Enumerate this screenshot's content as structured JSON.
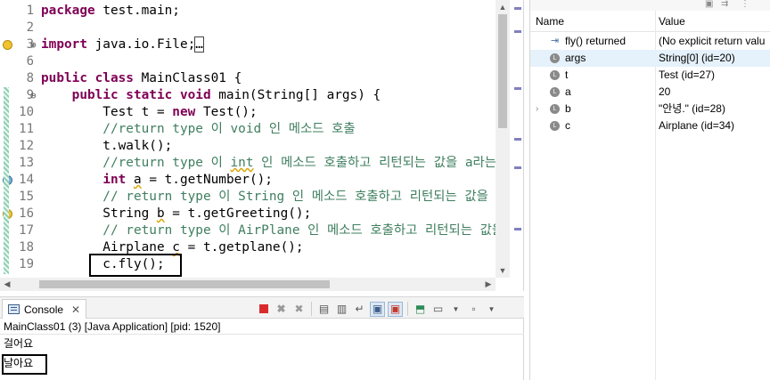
{
  "editor": {
    "lines": [
      {
        "num": "1",
        "marker": "",
        "fold": "",
        "segs": [
          [
            "kw",
            "package"
          ],
          [
            "tx",
            " test.main;"
          ]
        ]
      },
      {
        "num": "2",
        "marker": "",
        "fold": "",
        "segs": []
      },
      {
        "num": "3",
        "marker": "warn",
        "fold": "⊕",
        "segs": [
          [
            "kw",
            "import"
          ],
          [
            "tx",
            " java.io.File;"
          ],
          [
            "box",
            "…"
          ]
        ]
      },
      {
        "num": "6",
        "marker": "",
        "fold": "",
        "segs": []
      },
      {
        "num": "8",
        "marker": "",
        "fold": "",
        "segs": [
          [
            "kw",
            "public class"
          ],
          [
            "tx",
            " MainClass01 {"
          ]
        ]
      },
      {
        "num": "9",
        "marker": "",
        "fold": "⊖",
        "segs": [
          [
            "tx",
            "    "
          ],
          [
            "kw",
            "public static void"
          ],
          [
            "tx",
            " main(String[] args) {"
          ]
        ]
      },
      {
        "num": "10",
        "marker": "",
        "fold": "",
        "segs": [
          [
            "tx",
            "        Test t = "
          ],
          [
            "kw",
            "new"
          ],
          [
            "tx",
            " Test();"
          ]
        ]
      },
      {
        "num": "11",
        "marker": "",
        "fold": "",
        "segs": [
          [
            "cm",
            "        //return type 이 void 인 메소드 호출"
          ]
        ]
      },
      {
        "num": "12",
        "marker": "",
        "fold": "",
        "segs": [
          [
            "tx",
            "        t.walk();"
          ]
        ]
      },
      {
        "num": "13",
        "marker": "",
        "fold": "",
        "segs": [
          [
            "cm",
            "        //return type 이 "
          ],
          [
            "cmu",
            "int"
          ],
          [
            "cm",
            " 인 메소드 호출하고 리턴되는 값을 a라는"
          ]
        ]
      },
      {
        "num": "14",
        "marker": "bp",
        "fold": "",
        "segs": [
          [
            "tx",
            "        "
          ],
          [
            "kw",
            "int"
          ],
          [
            "tx",
            " "
          ],
          [
            "txu",
            "a"
          ],
          [
            "tx",
            " = t.getNumber();"
          ]
        ]
      },
      {
        "num": "15",
        "marker": "",
        "fold": "",
        "segs": [
          [
            "cm",
            "        // return type 이 String 인 메소드 호출하고 리턴되는 값을 b"
          ]
        ]
      },
      {
        "num": "16",
        "marker": "warn",
        "fold": "",
        "segs": [
          [
            "tx",
            "        String "
          ],
          [
            "txu",
            "b"
          ],
          [
            "tx",
            " = t.getGreeting();"
          ]
        ]
      },
      {
        "num": "17",
        "marker": "",
        "fold": "",
        "segs": [
          [
            "cm",
            "        // return type 이 AirPlane 인 메소드 호출하고 리턴되는 값을"
          ]
        ]
      },
      {
        "num": "18",
        "marker": "",
        "fold": "",
        "segs": [
          [
            "tx",
            "        Airplane "
          ],
          [
            "txu",
            "c"
          ],
          [
            "tx",
            " = t.getplane();"
          ]
        ]
      },
      {
        "num": "19",
        "marker": "",
        "fold": "",
        "segs": [
          [
            "tx",
            "        c.fly();"
          ]
        ]
      }
    ]
  },
  "console": {
    "tab_label": "Console",
    "description": "MainClass01 (3) [Java Application]  [pid: 1520]",
    "output": [
      "걸어요",
      "날아요"
    ]
  },
  "variables": {
    "col_name": "Name",
    "col_value": "Value",
    "rows": [
      {
        "name": "fly() returned",
        "value": "(No explicit return valu",
        "icon": "return",
        "expandable": false,
        "selected": false
      },
      {
        "name": "args",
        "value": "String[0]  (id=20)",
        "icon": "local",
        "expandable": false,
        "selected": true
      },
      {
        "name": "t",
        "value": "Test  (id=27)",
        "icon": "local",
        "expandable": false,
        "selected": false
      },
      {
        "name": "a",
        "value": "20",
        "icon": "local",
        "expandable": false,
        "selected": false
      },
      {
        "name": "b",
        "value": "\"안녕.\" (id=28)",
        "icon": "local",
        "expandable": true,
        "selected": false
      },
      {
        "name": "c",
        "value": "Airplane  (id=34)",
        "icon": "local",
        "expandable": false,
        "selected": false
      }
    ]
  },
  "colors": {
    "keyword": "#7f0055",
    "comment": "#3f7f5f",
    "selected_row": "#e5f1fb",
    "terminate_button": "#d92b2b"
  },
  "icons": {
    "console_tab": "console-icon",
    "close": "close-icon",
    "terminate": "terminate-icon",
    "remove_launch": "remove-launch-icon",
    "remove_all": "remove-all-icon",
    "clear": "clear-console-icon",
    "scroll_lock": "scroll-lock-icon",
    "word_wrap": "word-wrap-icon",
    "show_on_out": "show-console-on-output-icon",
    "show_on_err": "show-console-on-error-icon",
    "pin": "pin-console-icon",
    "display": "display-selected-console-icon",
    "open_console": "open-console-icon"
  }
}
